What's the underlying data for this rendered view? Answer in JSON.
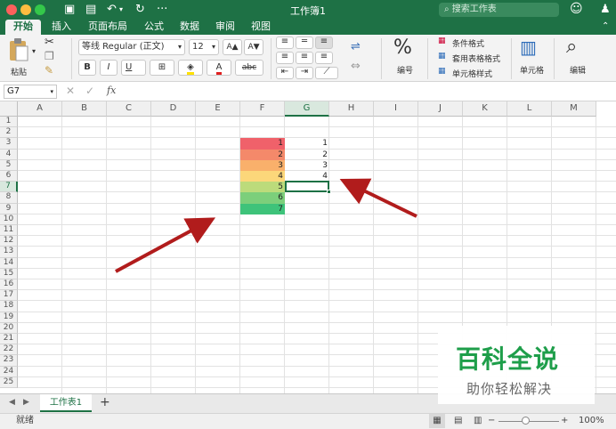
{
  "window": {
    "title": "工作簿1",
    "search_placeholder": "搜索工作表"
  },
  "tabs": [
    "开始",
    "插入",
    "页面布局",
    "公式",
    "数据",
    "审阅",
    "视图"
  ],
  "ribbon": {
    "paste_label": "粘贴",
    "font_name": "等线 Regular (正文)",
    "font_size": "12",
    "grow_font": "A▲",
    "shrink_font": "A▼",
    "bold": "B",
    "italic": "I",
    "underline": "U",
    "abc": "abc",
    "number_label": "编号",
    "percent": "%",
    "conditional_format": "条件格式",
    "table_format": "套用表格格式",
    "cell_style": "单元格样式",
    "cells_label": "单元格",
    "edit_label": "编辑"
  },
  "formula": {
    "name_box": "G7",
    "fx": "fx"
  },
  "columns": [
    "A",
    "B",
    "C",
    "D",
    "E",
    "F",
    "G",
    "H",
    "I",
    "J",
    "K",
    "L",
    "M"
  ],
  "rows": [
    "1",
    "2",
    "3",
    "4",
    "5",
    "6",
    "7",
    "8",
    "9",
    "10",
    "11",
    "12",
    "13",
    "14",
    "15",
    "16",
    "17",
    "18",
    "19",
    "20",
    "21",
    "22",
    "23",
    "24",
    "25"
  ],
  "f_values": [
    "1",
    "2",
    "3",
    "4",
    "5",
    "6",
    "7"
  ],
  "f_colors": [
    "#f0616a",
    "#f4896a",
    "#f9b06b",
    "#fcd77a",
    "#bcdb7b",
    "#7ccf7b",
    "#3ec37a"
  ],
  "g_values": [
    "1",
    "2",
    "3",
    "4"
  ],
  "sheet": {
    "tab": "工作表1",
    "add": "+"
  },
  "status": {
    "ready": "就绪",
    "zoom": "100%",
    "minus": "−",
    "plus": "+"
  },
  "watermark": {
    "line1": "百科全说",
    "line2": "助你轻松解决"
  },
  "colors": {
    "accent": "#1e7145",
    "arrow": "#b11c1c"
  }
}
